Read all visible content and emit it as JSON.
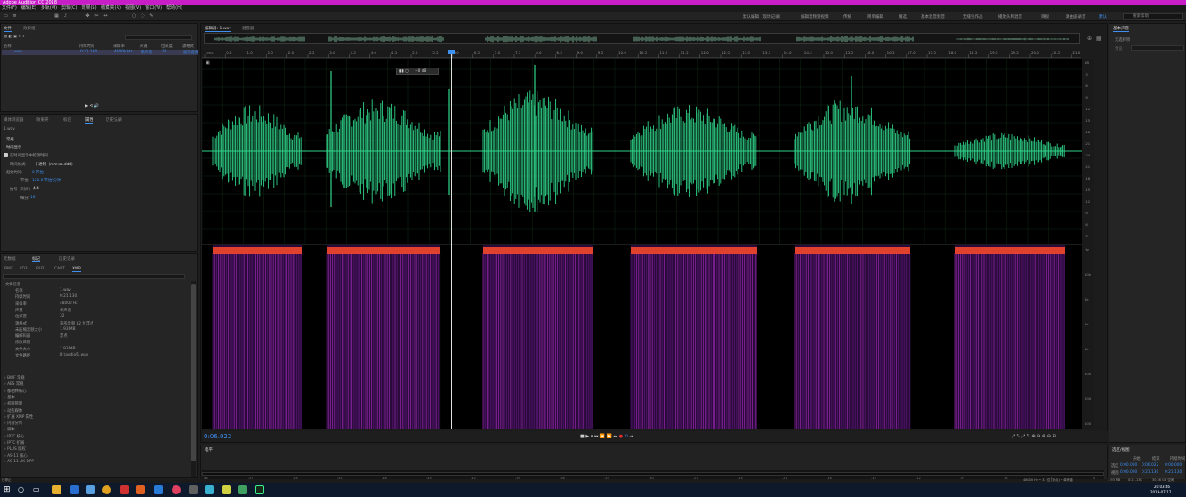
{
  "app": {
    "title": "Adobe Audition CC 2018",
    "menu": [
      "文件(F)",
      "编辑(E)",
      "多轨(M)",
      "剪辑(C)",
      "效果(S)",
      "收藏夹(R)",
      "视图(V)",
      "窗口(W)",
      "帮助(H)"
    ],
    "workspaces": [
      "默认编辑（现场记录）",
      "编辑音频到视频",
      "传统",
      "简单编辑",
      "精选",
      "基本混音频音",
      "无缝包作品",
      "播放头和混音",
      "目视",
      "路由器录音"
    ],
    "active_workspace": "默认",
    "search_placeholder": "搜索帮助"
  },
  "files_panel": {
    "tabs": [
      "文件",
      "效果组"
    ],
    "columns": [
      "名称",
      "持续时间",
      "采样率",
      "声道",
      "位深度",
      "源格式"
    ],
    "row": {
      "name": "1.wav",
      "duration": "0:21.130",
      "rate": "48000 Hz",
      "channels": "单声道",
      "depth": "32",
      "format": "波形音频"
    }
  },
  "props_panel": {
    "tabs": [
      "媒体浏览器",
      "效果夹",
      "标记",
      "属性",
      "历史记录"
    ],
    "file": "1.wav",
    "section": "常规",
    "subsection": "时间显示",
    "checkbox_label": "在时间显示中检测时间",
    "display_label": "时间格式:",
    "display_value": "十进制（mm:ss.ddd）",
    "beat_label": "起始时间:",
    "beat_value": "0 节拍",
    "tempo_label": "节拍:",
    "tempo_value": "120.0 节拍/分钟",
    "sig_label": "拍号（时间）:",
    "sig_value": "4/4",
    "sub_label": "细分:",
    "sub_value": "16"
  },
  "meta_panel": {
    "tabs": [
      "元数据",
      "标记",
      "历史记录"
    ],
    "subtabs": [
      "BWF",
      "ID3",
      "RIFF",
      "CART",
      "XMP"
    ],
    "heading": "文件信息",
    "fields": [
      [
        "名称",
        "1.wav"
      ],
      [
        "持续时间",
        "0:21.130"
      ],
      [
        "采样率",
        "48000 Hz"
      ],
      [
        "声道",
        "单声道"
      ],
      [
        "位深度",
        "32"
      ],
      [
        "源格式",
        "波形音频 32 位浮点"
      ],
      [
        "未压缩音频大小",
        "1.93 MB"
      ],
      [
        "编解码器",
        "浮点"
      ],
      [
        "修改日期",
        ""
      ],
      [
        "文件大小",
        "1.93 MB"
      ],
      [
        "文件路径",
        "D:\\audio\\1.wav"
      ]
    ],
    "groups": [
      "BWF 常规",
      "AES 常规",
      "都柏林核心",
      "基本",
      "权限管理",
      "动态媒体",
      "扩展 XMP 属性",
      "内容分析",
      "脚本",
      "IPTC 核心",
      "IPTC 扩展",
      "PLUS 版权",
      "AS-11 核心",
      "AS-11 UK DPP"
    ]
  },
  "editor": {
    "tab": "编辑器: 1.wav",
    "tab2": "混音器",
    "hud_value": "+0 dB",
    "timecode": "0:06.022",
    "ruler_ticks": [
      "hms",
      "0.5",
      "1.0",
      "1.5",
      "2.0",
      "2.5",
      "3.0",
      "3.5",
      "4.0",
      "4.5",
      "5.0",
      "5.5",
      "6.0",
      "6.5",
      "7.0",
      "7.5",
      "8.0",
      "8.5",
      "9.0",
      "9.5",
      "10.0",
      "10.5",
      "11.0",
      "11.5",
      "12.0",
      "12.5",
      "13.0",
      "13.5",
      "14.0",
      "14.5",
      "15.0",
      "15.5",
      "16.0",
      "16.5",
      "17.0",
      "17.5",
      "18.0",
      "18.5",
      "19.0",
      "19.5",
      "20.0",
      "20.5",
      "21.0"
    ],
    "db_scale": [
      "dB",
      "-3",
      "-6",
      "-9",
      "-12",
      "-15",
      "-18",
      "-21",
      "-24",
      "-21",
      "-18",
      "-15",
      "-12",
      "-9",
      "-6",
      "-3"
    ],
    "hz_scale": [
      "Hz",
      "10k",
      "5k",
      "2k",
      "1k",
      "500",
      "200",
      "100"
    ],
    "mixer_tab": "电平",
    "mixer_ticks": [
      "dB",
      "-57",
      "-54",
      "-51",
      "-48",
      "-45",
      "-42",
      "-39",
      "-36",
      "-33",
      "-30",
      "-27",
      "-24",
      "-21",
      "-18",
      "-15",
      "-12",
      "-9",
      "-6",
      "-3",
      "0"
    ]
  },
  "right_panel": {
    "tab": "基本声音",
    "subtab": "无选择项",
    "hint": "预设"
  },
  "selection_panel": {
    "tab": "选区/视图",
    "headers": [
      "开始",
      "结束",
      "持续时间"
    ],
    "rows": [
      [
        "选区",
        "0:00.000",
        "0:06.022",
        "0:00.000"
      ],
      [
        "视图",
        "0:00.000",
        "0:21.130",
        "0:21.130"
      ]
    ]
  },
  "status": {
    "left": "已停止",
    "right": [
      "48000 Hz • 32 位 (浮点) • 单声道",
      "1.93 MB",
      "0:21.130",
      "30.56 GB 空闲"
    ],
    "clock_time": "20:03:46",
    "clock_date": "2019-07-17"
  },
  "colors": {
    "accent": "#3d8ff0",
    "wave": "#2fd48a",
    "spectral": "#ff4b2a",
    "titlebar": "#c81ec8"
  }
}
